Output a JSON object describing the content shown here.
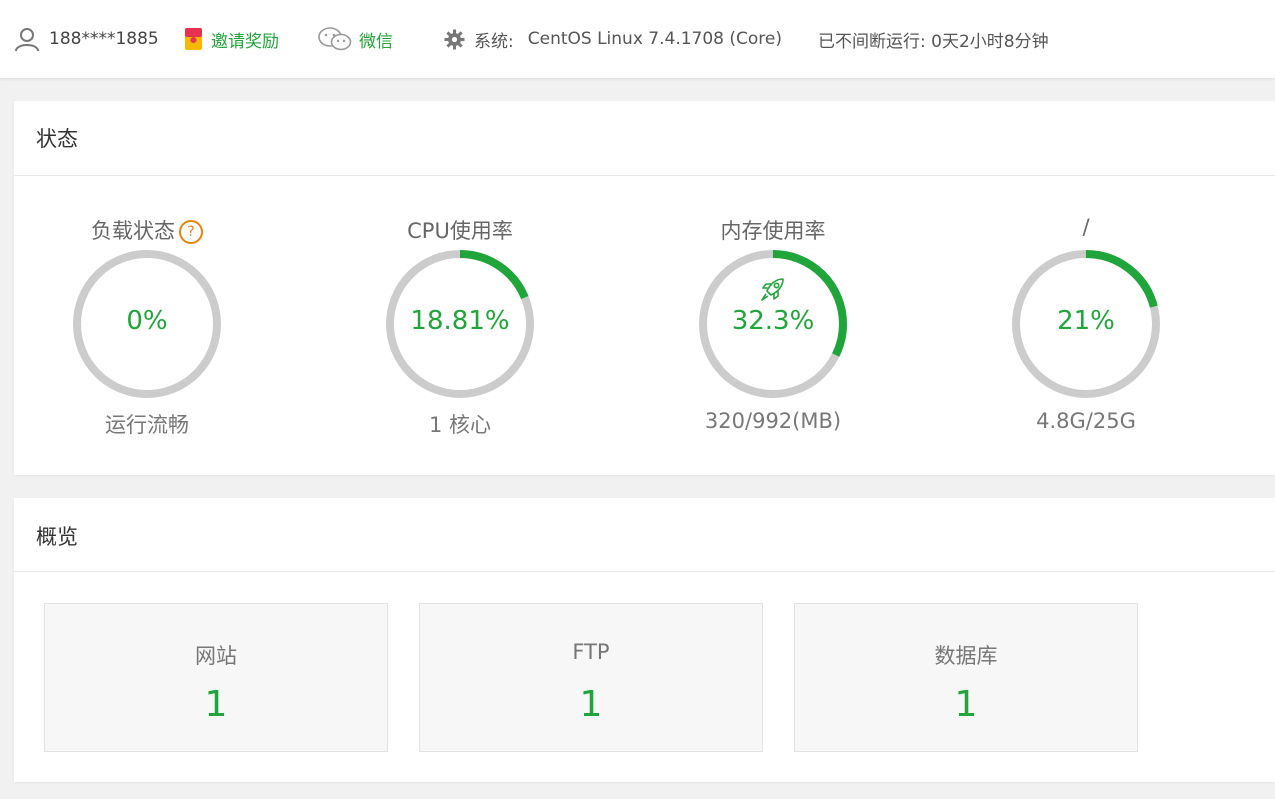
{
  "topbar": {
    "username": "188****1885",
    "invite_label": "邀请奖励",
    "wechat_label": "微信",
    "system_label": "系统:",
    "system_value": "CentOS Linux 7.4.1708 (Core)",
    "uptime": "已不间断运行: 0天2小时8分钟"
  },
  "status": {
    "title": "状态",
    "gauges": [
      {
        "label": "负载状态",
        "value_text": "0%",
        "fraction": 0.0,
        "sub": "运行流畅"
      },
      {
        "label": "CPU使用率",
        "value_text": "18.81%",
        "fraction": 0.1881,
        "sub": "1 核心"
      },
      {
        "label": "内存使用率",
        "value_text": "32.3%",
        "fraction": 0.323,
        "sub": "320/992(MB)"
      },
      {
        "label": "/",
        "value_text": "21%",
        "fraction": 0.21,
        "sub": "4.8G/25G"
      }
    ]
  },
  "overview": {
    "title": "概览",
    "cards": [
      {
        "name": "网站",
        "count": "1"
      },
      {
        "name": "FTP",
        "count": "1"
      },
      {
        "name": "数据库",
        "count": "1"
      }
    ]
  },
  "colors": {
    "accent": "#20a53a",
    "ring_track": "#cccccc",
    "help_icon": "#e8820c"
  },
  "icons": {
    "user": "user-icon",
    "invite": "gift-icon",
    "wechat": "wechat-icon",
    "system": "gear-icon",
    "help": "question-icon",
    "memory_boost": "rocket-icon"
  }
}
